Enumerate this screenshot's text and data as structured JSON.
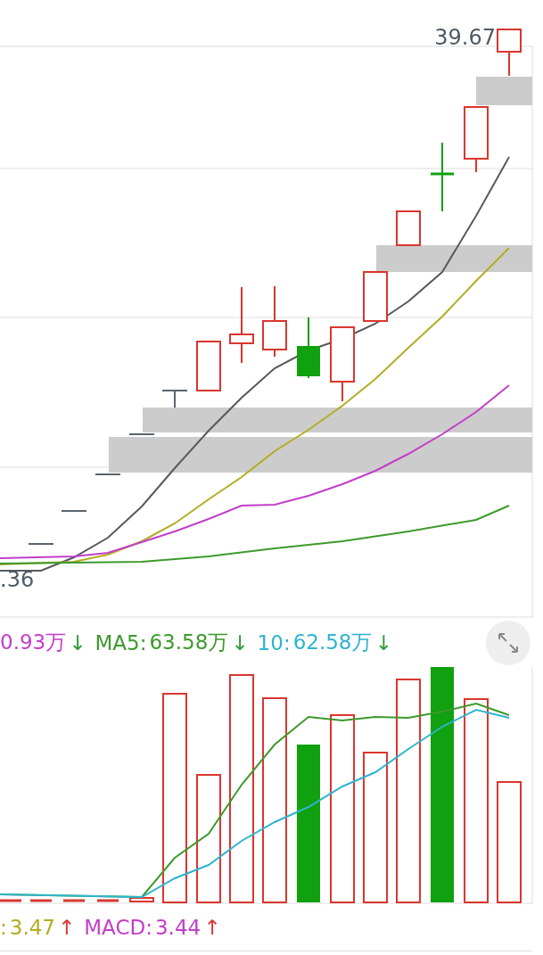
{
  "price_chart": {
    "high_label": "39.67",
    "low_label": ".36"
  },
  "volume_legend": [
    {
      "value": "0.93万",
      "arrow": "↓",
      "rising": false,
      "color": "#c23fc9"
    },
    {
      "label": "MA5:",
      "value": "63.58万",
      "arrow": "↓",
      "rising": false,
      "color": "#3d9a2c"
    },
    {
      "label": "10:",
      "value": "62.58万",
      "arrow": "↓",
      "rising": false,
      "color": "#2eb4cf"
    }
  ],
  "macd_legend": [
    {
      "label": ":",
      "value": "3.47",
      "arrow": "↑",
      "rising": true,
      "color": "#b3ad22"
    },
    {
      "label": "MACD:",
      "value": "3.44",
      "arrow": "↑",
      "rising": true,
      "color": "#c23fc9"
    }
  ]
}
